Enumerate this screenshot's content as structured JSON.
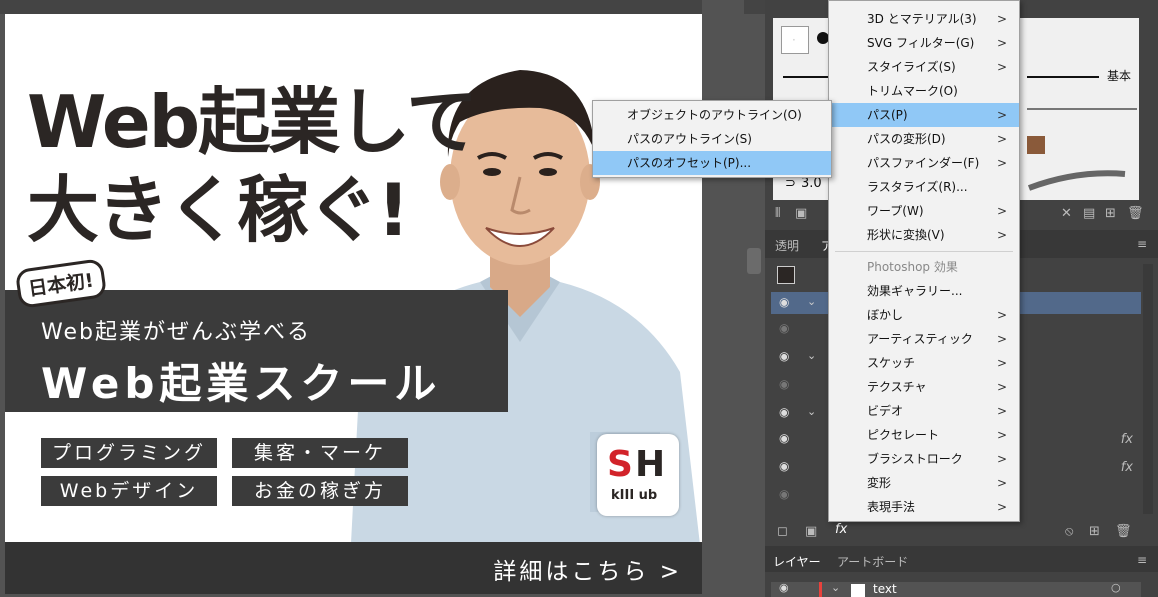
{
  "banner": {
    "headline_line1": "Web起業して",
    "headline_line2": "大きく稼ぐ!",
    "badge": "日本初!",
    "subtitle": "Web起業がぜんぶ学べる",
    "title": "Web起業スクール",
    "chips": [
      "プログラミング",
      "集客・マーケ",
      "Webデザイン",
      "お金の稼ぎ方"
    ],
    "logo_letters_s": "S",
    "logo_letters_h": "H",
    "logo_sub": "kIII ub",
    "cta": "詳細はこちら >"
  },
  "effect_menu": {
    "items": [
      {
        "label": "3D とマテリアル(3)",
        "submenu": true
      },
      {
        "label": "SVG フィルター(G)",
        "submenu": true
      },
      {
        "label": "スタイライズ(S)",
        "submenu": true
      },
      {
        "label": "トリムマーク(O)",
        "submenu": false
      },
      {
        "label": "パス(P)",
        "submenu": true,
        "highlighted": true
      },
      {
        "label": "パスの変形(D)",
        "submenu": true
      },
      {
        "label": "パスファインダー(F)",
        "submenu": true
      },
      {
        "label": "ラスタライズ(R)...",
        "submenu": false
      },
      {
        "label": "ワープ(W)",
        "submenu": true
      },
      {
        "label": "形状に変換(V)",
        "submenu": true
      }
    ],
    "photoshop_header": "Photoshop 効果",
    "photoshop_items": [
      {
        "label": "効果ギャラリー...",
        "submenu": false
      },
      {
        "label": "ぼかし",
        "submenu": true
      },
      {
        "label": "アーティスティック",
        "submenu": true
      },
      {
        "label": "スケッチ",
        "submenu": true
      },
      {
        "label": "テクスチャ",
        "submenu": true
      },
      {
        "label": "ビデオ",
        "submenu": true
      },
      {
        "label": "ピクセレート",
        "submenu": true
      },
      {
        "label": "ブラシストローク",
        "submenu": true
      },
      {
        "label": "変形",
        "submenu": true
      },
      {
        "label": "表現手法",
        "submenu": true
      }
    ],
    "arrow": ">"
  },
  "path_submenu": {
    "items": [
      {
        "label": "オブジェクトのアウトライン(O)",
        "highlighted": false
      },
      {
        "label": "パスのアウトライン(S)",
        "highlighted": false
      },
      {
        "label": "パスのオフセット(P)...",
        "highlighted": true
      }
    ]
  },
  "brush_panel": {
    "basic_label": "基本",
    "stroke_value": "3.0"
  },
  "appearance_panel": {
    "tab_transparency": "透明",
    "tab_partial": "ア",
    "fx_label": "fx"
  },
  "layers_panel": {
    "tab_layers": "レイヤー",
    "tab_artboards": "アートボード",
    "layer_name": "text"
  },
  "colors": {
    "menu_highlight": "#90c8f6",
    "panel_bg": "#424242",
    "logo_red": "#d2232a"
  }
}
